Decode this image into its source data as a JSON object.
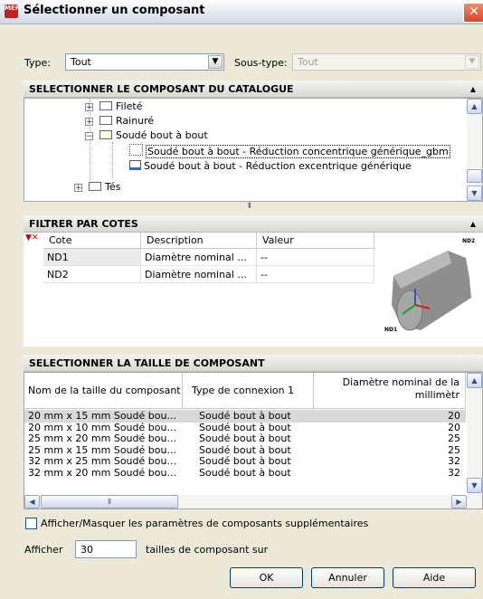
{
  "window": {
    "title": "Sélectionner un composant",
    "app_icon_label": "MEP",
    "close_glyph": "✕"
  },
  "type_row": {
    "type_label": "Type:",
    "type_value": "Tout",
    "subtype_label": "Sous-type:",
    "subtype_value": "Tout"
  },
  "catalog": {
    "heading": "SELECTIONNER LE COMPOSANT DU CATALOGUE",
    "items": [
      {
        "label": "Fileté",
        "kind": "folder"
      },
      {
        "label": "Rainuré",
        "kind": "folder"
      },
      {
        "label": "Soudé bout à bout",
        "kind": "folder-open"
      },
      {
        "label": "Soudé bout à bout - Réduction concentrique générique_gbm",
        "kind": "part",
        "selected": true
      },
      {
        "label": "Soudé bout à bout - Réduction excentrique générique",
        "kind": "part"
      },
      {
        "label": "Tés",
        "kind": "folder"
      }
    ]
  },
  "filter": {
    "heading": "FILTRER PAR COTES",
    "columns": [
      "Cote",
      "Description",
      "Valeur"
    ],
    "rows": [
      {
        "cote": "ND1",
        "description": "Diamètre nominal ...",
        "valeur": "--"
      },
      {
        "cote": "ND2",
        "description": "Diamètre nominal ...",
        "valeur": "--"
      }
    ],
    "preview_labels": {
      "top": "ND2",
      "bottom": "ND1"
    }
  },
  "sizes": {
    "heading": "SELECTIONNER LA TAILLE DE COMPOSANT",
    "columns": [
      "Nom de la taille du composant",
      "Type de connexion 1",
      "Diamètre nominal de la",
      "millimètr"
    ],
    "rows": [
      {
        "name": "20 mm x 15 mm Soudé bou...",
        "conn": "Soudé bout à bout",
        "dn": "20"
      },
      {
        "name": "20 mm x 10 mm Soudé bou...",
        "conn": "Soudé bout à bout",
        "dn": "20"
      },
      {
        "name": "25 mm x 20 mm Soudé bou...",
        "conn": "Soudé bout à bout",
        "dn": "25"
      },
      {
        "name": "25 mm x 15 mm Soudé bou...",
        "conn": "Soudé bout à bout",
        "dn": "25"
      },
      {
        "name": "32 mm x 25 mm Soudé bou...",
        "conn": "Soudé bout à bout",
        "dn": "32"
      },
      {
        "name": "32 mm x 20 mm Soudé bou...",
        "conn": "Soudé bout à bout",
        "dn": "32"
      }
    ]
  },
  "options": {
    "checkbox_label": "Afficher/Masquer les paramètres de composants supplémentaires",
    "show_label": "Afficher",
    "show_value": "30",
    "show_suffix": "tailles de composant sur"
  },
  "buttons": {
    "ok": "OK",
    "cancel": "Annuler",
    "help": "Aide"
  },
  "colors": {
    "accent_selection": "#316ac5",
    "close_button": "#d84526"
  }
}
